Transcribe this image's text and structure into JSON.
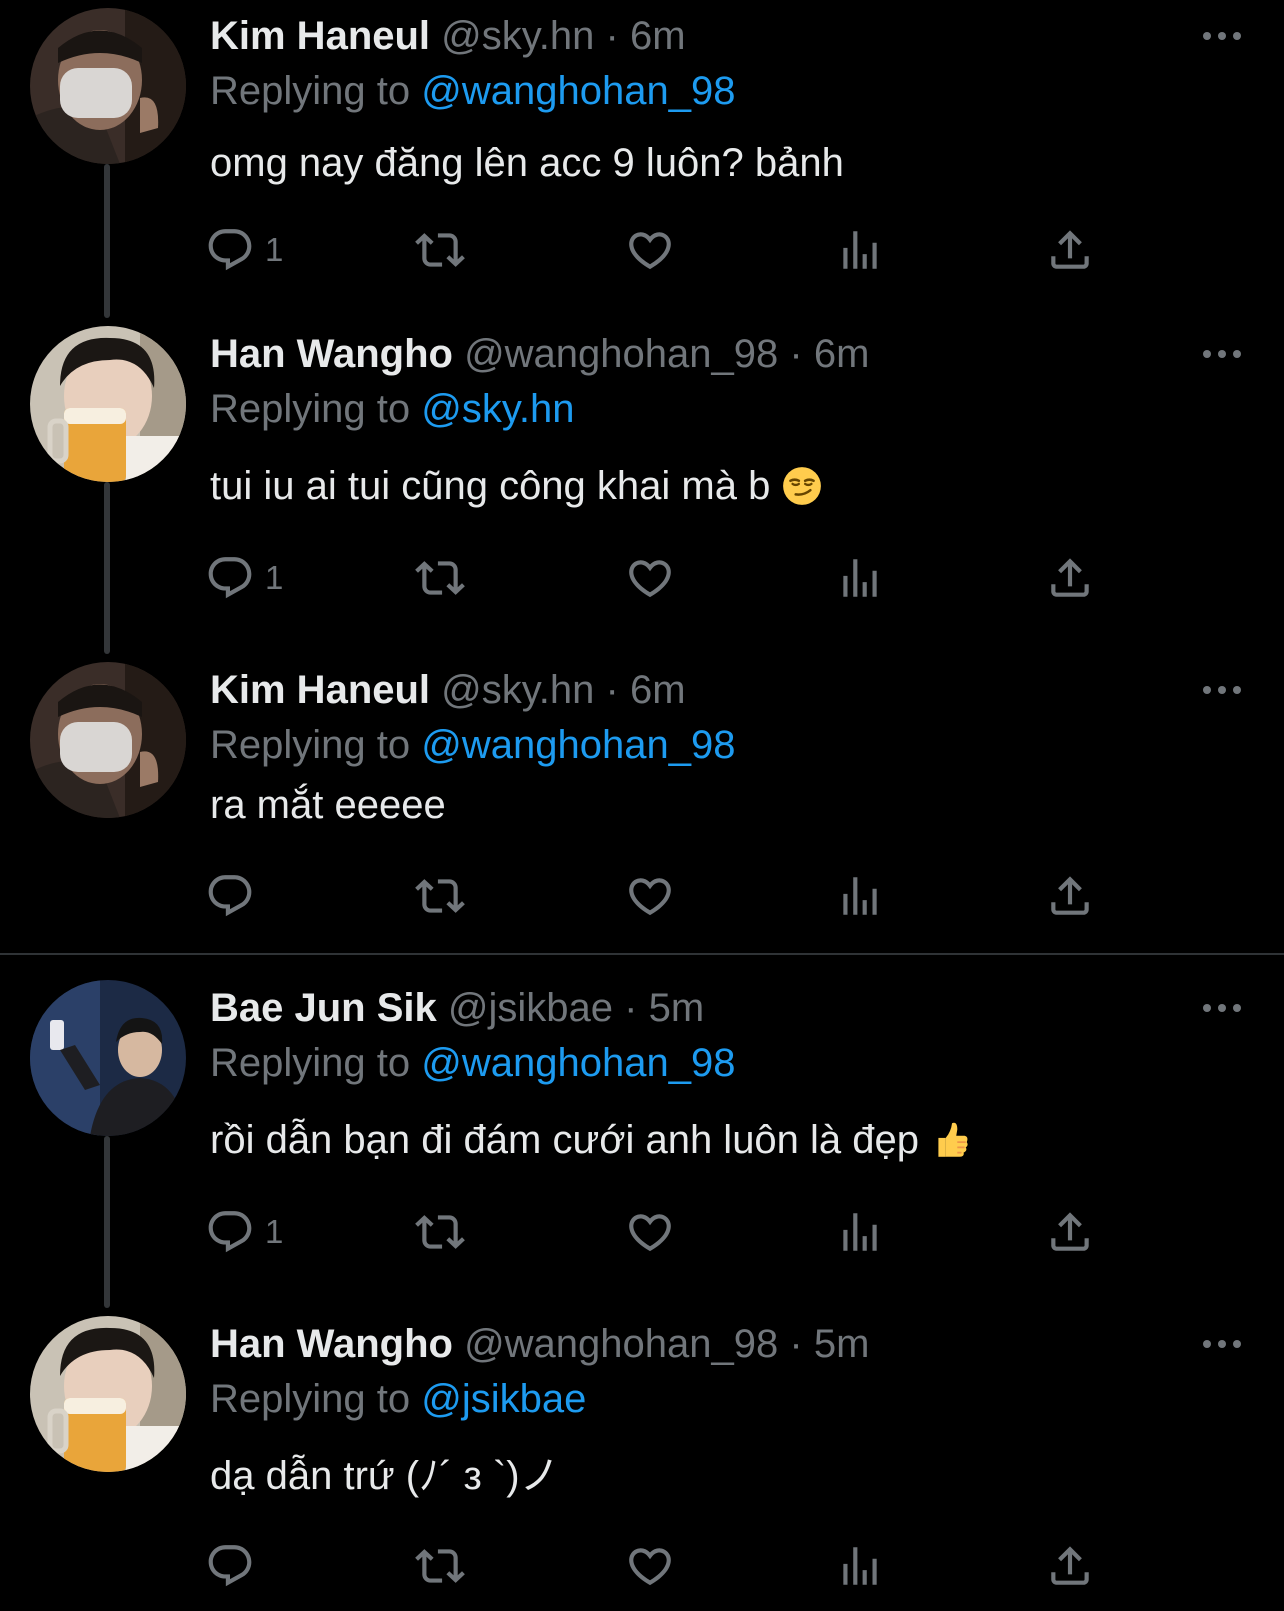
{
  "colors": {
    "background": "#000000",
    "text_primary": "#e7e9ea",
    "text_secondary": "#71767b",
    "accent": "#1d9bf0",
    "thread_line": "#333639"
  },
  "replying_label": "Replying to",
  "separator": "·",
  "tweets": [
    {
      "name": "Kim Haneul",
      "handle": "@sky.hn",
      "time": "6m",
      "reply_to": "@wanghohan_98",
      "text": "omg nay đăng lên acc 9 luôn? bảnh",
      "reply_count": "1",
      "avatar": "masked-person-avatar"
    },
    {
      "name": "Han Wangho",
      "handle": "@wanghohan_98",
      "time": "6m",
      "reply_to": "@sky.hn",
      "text": "tui iu ai tui cũng công khai mà b",
      "emoji": "smirking-face-emoji",
      "reply_count": "1",
      "avatar": "person-with-beer-avatar"
    },
    {
      "name": "Kim Haneul",
      "handle": "@sky.hn",
      "time": "6m",
      "reply_to": "@wanghohan_98",
      "text": "ra mắt eeeee",
      "reply_count": "",
      "avatar": "masked-person-avatar"
    },
    {
      "name": "Bae Jun Sik",
      "handle": "@jsikbae",
      "time": "5m",
      "reply_to": "@wanghohan_98",
      "text": "rồi dẫn bạn đi đám cưới anh luôn là đẹp",
      "emoji": "thumbs-up-emoji",
      "reply_count": "1",
      "avatar": "selfie-person-avatar"
    },
    {
      "name": "Han Wangho",
      "handle": "@wanghohan_98",
      "time": "5m",
      "reply_to": "@jsikbae",
      "text": "dạ dẫn trứ (ﾉ´ з `)ノ",
      "reply_count": "",
      "avatar": "person-with-beer-avatar"
    }
  ]
}
